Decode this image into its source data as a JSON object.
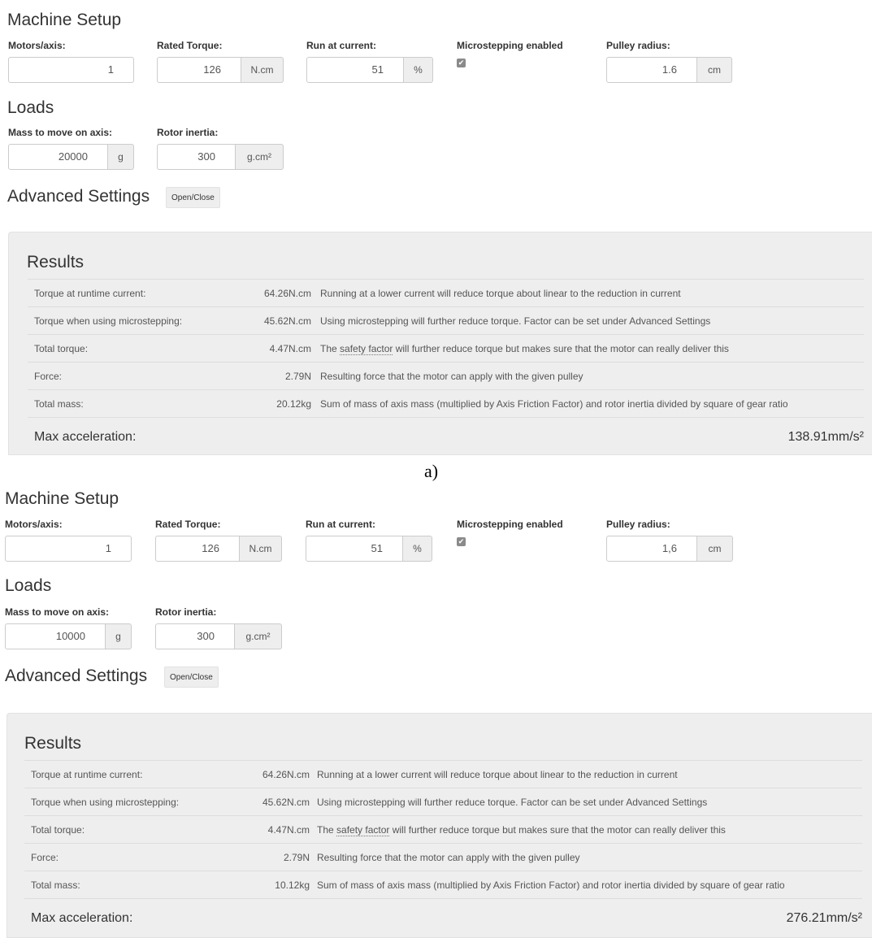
{
  "panel_a": {
    "machine_setup_title": "Machine Setup",
    "motors_label": "Motors/axis:",
    "motors_value": "1",
    "rated_torque_label": "Rated Torque:",
    "rated_torque_value": "126",
    "rated_torque_unit": "N.cm",
    "run_current_label": "Run at current:",
    "run_current_value": "51",
    "run_current_unit": "%",
    "microstepping_label": "Microstepping enabled",
    "microstepping_checked": true,
    "pulley_label": "Pulley radius:",
    "pulley_value": "1.6",
    "pulley_unit": "cm",
    "loads_title": "Loads",
    "mass_label": "Mass to move on axis:",
    "mass_value": "20000",
    "mass_unit": "g",
    "rotor_label": "Rotor inertia:",
    "rotor_value": "300",
    "rotor_unit": "g.cm²",
    "advanced_title": "Advanced Settings",
    "advanced_button": "Open/Close",
    "results_title": "Results",
    "rows": [
      {
        "label": "Torque at runtime current:",
        "value": "64.26N.cm",
        "desc": "Running at a lower current will reduce torque about linear to the reduction in current"
      },
      {
        "label": "Torque when using microstepping:",
        "value": "45.62N.cm",
        "desc": "Using microstepping will further reduce torque. Factor can be set under Advanced Settings"
      },
      {
        "label": "Total torque:",
        "value": "4.47N.cm",
        "desc_pre": "The ",
        "desc_link": "safety factor",
        "desc_post": " will further reduce torque but makes sure that the motor can really deliver this"
      },
      {
        "label": "Force:",
        "value": "2.79N",
        "desc": "Resulting force that the motor can apply with the given pulley"
      },
      {
        "label": "Total mass:",
        "value": "20.12kg",
        "desc": "Sum of mass of axis mass (multiplied by Axis Friction Factor) and rotor inertia divided by square of gear ratio"
      }
    ],
    "max_accel_label": "Max acceleration:",
    "max_accel_value": "138.91mm/s²"
  },
  "caption": "a)",
  "panel_b": {
    "machine_setup_title": "Machine Setup",
    "motors_label": "Motors/axis:",
    "motors_value": "1",
    "rated_torque_label": "Rated Torque:",
    "rated_torque_value": "126",
    "rated_torque_unit": "N.cm",
    "run_current_label": "Run at current:",
    "run_current_value": "51",
    "run_current_unit": "%",
    "microstepping_label": "Microstepping enabled",
    "microstepping_checked": true,
    "pulley_label": "Pulley radius:",
    "pulley_value": "1,6",
    "pulley_unit": "cm",
    "loads_title": "Loads",
    "mass_label": "Mass to move on axis:",
    "mass_value": "10000",
    "mass_unit": "g",
    "rotor_label": "Rotor inertia:",
    "rotor_value": "300",
    "rotor_unit": "g.cm²",
    "advanced_title": "Advanced Settings",
    "advanced_button": "Open/Close",
    "results_title": "Results",
    "rows": [
      {
        "label": "Torque at runtime current:",
        "value": "64.26N.cm",
        "desc": "Running at a lower current will reduce torque about linear to the reduction in current"
      },
      {
        "label": "Torque when using microstepping:",
        "value": "45.62N.cm",
        "desc": "Using microstepping will further reduce torque. Factor can be set under Advanced Settings"
      },
      {
        "label": "Total torque:",
        "value": "4.47N.cm",
        "desc_pre": "The ",
        "desc_link": "safety factor",
        "desc_post": " will further reduce torque but makes sure that the motor can really deliver this"
      },
      {
        "label": "Force:",
        "value": "2.79N",
        "desc": "Resulting force that the motor can apply with the given pulley"
      },
      {
        "label": "Total mass:",
        "value": "10.12kg",
        "desc": "Sum of mass of axis mass (multiplied by Axis Friction Factor) and rotor inertia divided by square of gear ratio"
      }
    ],
    "max_accel_label": "Max acceleration:",
    "max_accel_value": "276.21mm/s²"
  }
}
